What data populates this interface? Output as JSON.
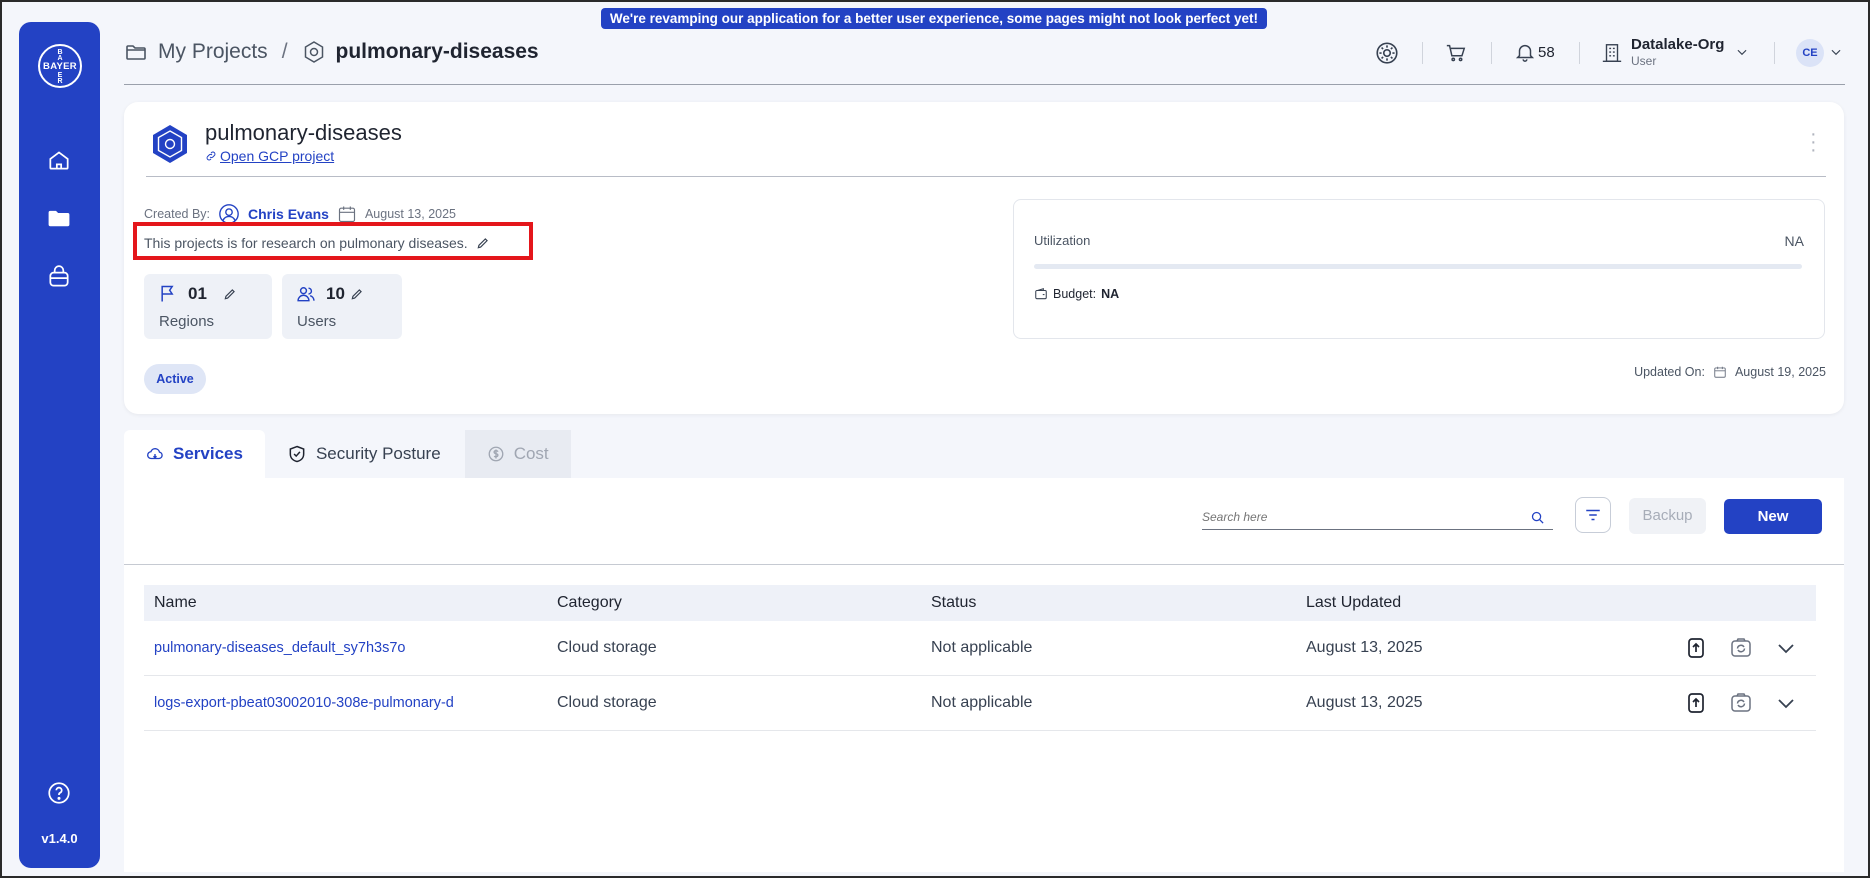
{
  "banner": "We're revamping our application for a better user experience, some pages might not look perfect yet!",
  "sidebar": {
    "logo_text": "BAYER",
    "logo_letters": [
      "B",
      "A",
      "Y",
      "E",
      "R"
    ],
    "items": [
      {
        "icon": "home-icon"
      },
      {
        "icon": "folder-icon"
      },
      {
        "icon": "bag-icon"
      }
    ],
    "help_icon": "help-icon",
    "version": "v1.4.0"
  },
  "header": {
    "breadcrumb_root": "My Projects",
    "breadcrumb_sep": "/",
    "breadcrumb_current": "pulmonary-diseases",
    "notification_count": "58",
    "org_name": "Datalake-Org",
    "org_role": "User",
    "avatar_initials": "CE"
  },
  "project": {
    "title": "pulmonary-diseases",
    "link_label": "Open GCP project",
    "created_by_label": "Created By:",
    "author": "Chris Evans",
    "created_date": "August 13, 2025",
    "description": "This projects is for research on pulmonary diseases.",
    "regions_count": "01",
    "regions_label": "Regions",
    "users_count": "10",
    "users_label": "Users",
    "status": "Active",
    "utilization_label": "Utilization",
    "utilization_value": "NA",
    "utilization_fraction": 0,
    "budget_label": "Budget:",
    "budget_value": "NA",
    "updated_label": "Updated On:",
    "updated_date": "August 19, 2025"
  },
  "tabs": [
    {
      "label": "Services",
      "icon": "cloud-icon",
      "state": "active"
    },
    {
      "label": "Security Posture",
      "icon": "shield-icon",
      "state": "normal"
    },
    {
      "label": "Cost",
      "icon": "dollar-icon",
      "state": "disabled"
    }
  ],
  "toolbar": {
    "search_placeholder": "Search here",
    "backup_label": "Backup",
    "new_label": "New"
  },
  "table": {
    "columns": [
      "Name",
      "Category",
      "Status",
      "Last Updated"
    ],
    "rows": [
      {
        "name": "pulmonary-diseases_default_sy7h3s7o",
        "category": "Cloud storage",
        "status": "Not applicable",
        "updated": "August 13, 2025"
      },
      {
        "name": "logs-export-pbeat03002010-308e-pulmonary-d",
        "category": "Cloud storage",
        "status": "Not applicable",
        "updated": "August 13, 2025"
      }
    ]
  },
  "colors": {
    "brand": "#2342c4",
    "highlight": "#e4161b"
  }
}
